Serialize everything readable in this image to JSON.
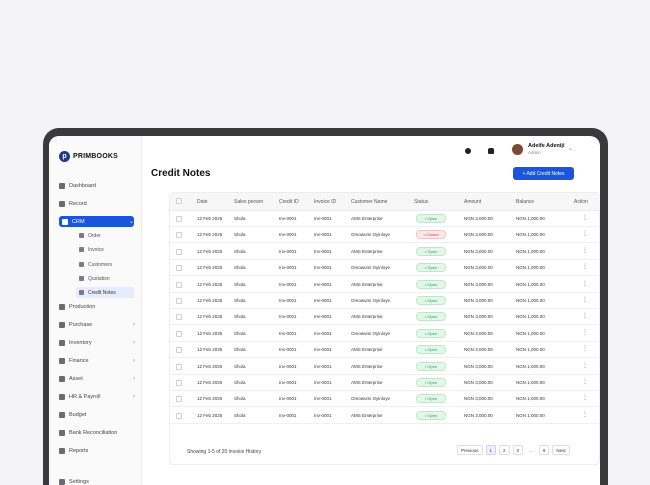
{
  "app": {
    "logo_text": "PRIMBOOKS",
    "logo_mark": "p"
  },
  "sidebar": {
    "items": [
      {
        "label": "Dashboard",
        "icon": "grid-icon",
        "chevron": false
      },
      {
        "label": "Record",
        "icon": "archive-icon",
        "chevron": false
      },
      {
        "label": "CRM",
        "icon": "crm-icon",
        "chevron": true,
        "active": true
      },
      {
        "label": "Production",
        "icon": "factory-icon",
        "chevron": false
      },
      {
        "label": "Purchase",
        "icon": "tag-icon",
        "chevron": true
      },
      {
        "label": "Inventory",
        "icon": "box-icon",
        "chevron": true
      },
      {
        "label": "Finance",
        "icon": "wallet-icon",
        "chevron": true
      },
      {
        "label": "Asset",
        "icon": "asset-icon",
        "chevron": true
      },
      {
        "label": "HR & Payroll",
        "icon": "people-icon",
        "chevron": true
      },
      {
        "label": "Budget",
        "icon": "budget-icon",
        "chevron": false
      },
      {
        "label": "Bank Reconciliation",
        "icon": "bank-icon",
        "chevron": false
      },
      {
        "label": "Reports",
        "icon": "report-icon",
        "chevron": false
      },
      {
        "label": "Settings",
        "icon": "gear-icon",
        "chevron": false
      }
    ],
    "crm_sub": [
      {
        "label": "Order",
        "icon": "bag-icon"
      },
      {
        "label": "Invoice",
        "icon": "document-icon"
      },
      {
        "label": "Customers",
        "icon": "users-icon"
      },
      {
        "label": "Quotation",
        "icon": "document-icon"
      },
      {
        "label": "Credit Notes",
        "icon": "note-icon",
        "active": true
      }
    ]
  },
  "topbar": {
    "user_name": "Adeife Adeniji",
    "user_role": "Admin"
  },
  "page": {
    "title": "Credit Notes",
    "add_button": "+ Add Credit Notes"
  },
  "table": {
    "headers": [
      "Date",
      "Sales person",
      "Credit ID",
      "Invoice ID",
      "Customer Name",
      "Status",
      "Amount",
      "Balance",
      "Action"
    ],
    "rows": [
      {
        "date": "12 Feb 2025",
        "sales": "Shola",
        "credit": "Inv-0001",
        "invoice": "Inv-0001",
        "customer": "AMS Enterprise",
        "status": "Open",
        "amount": "NGN 3,000.00",
        "balance": "NGN 1,000.00"
      },
      {
        "date": "12 Feb 2025",
        "sales": "Shola",
        "credit": "Inv-0001",
        "invoice": "Inv-0001",
        "customer": "Omowumi Oyinloye",
        "status": "Closed",
        "amount": "NGN 3,000.00",
        "balance": "NGN 1,000.00"
      },
      {
        "date": "12 Feb 2025",
        "sales": "Shola",
        "credit": "Inv-0001",
        "invoice": "Inv-0001",
        "customer": "AMS Enterprise",
        "status": "Open",
        "amount": "NGN 3,000.00",
        "balance": "NGN 1,000.00"
      },
      {
        "date": "12 Feb 2025",
        "sales": "Shola",
        "credit": "Inv-0001",
        "invoice": "Inv-0001",
        "customer": "Omowumi Oyinloye",
        "status": "Open",
        "amount": "NGN 3,000.00",
        "balance": "NGN 1,000.00"
      },
      {
        "date": "12 Feb 2025",
        "sales": "Shola",
        "credit": "Inv-0001",
        "invoice": "Inv-0001",
        "customer": "AMS Enterprise",
        "status": "Open",
        "amount": "NGN 3,000.00",
        "balance": "NGN 1,000.00"
      },
      {
        "date": "12 Feb 2025",
        "sales": "Shola",
        "credit": "Inv-0001",
        "invoice": "Inv-0001",
        "customer": "Omowumi Oyinloye",
        "status": "Open",
        "amount": "NGN 3,000.00",
        "balance": "NGN 1,000.00"
      },
      {
        "date": "12 Feb 2025",
        "sales": "Shola",
        "credit": "Inv-0001",
        "invoice": "Inv-0001",
        "customer": "AMS Enterprise",
        "status": "Open",
        "amount": "NGN 3,000.00",
        "balance": "NGN 1,000.00"
      },
      {
        "date": "12 Feb 2025",
        "sales": "Shola",
        "credit": "Inv-0001",
        "invoice": "Inv-0001",
        "customer": "Omowumi Oyinloye",
        "status": "Open",
        "amount": "NGN 3,000.00",
        "balance": "NGN 1,000.00"
      },
      {
        "date": "12 Feb 2025",
        "sales": "Shola",
        "credit": "Inv-0001",
        "invoice": "Inv-0001",
        "customer": "AMS Enterprise",
        "status": "Open",
        "amount": "NGN 3,000.00",
        "balance": "NGN 1,000.00"
      },
      {
        "date": "12 Feb 2025",
        "sales": "Shola",
        "credit": "Inv-0001",
        "invoice": "Inv-0001",
        "customer": "AMS Enterprise",
        "status": "Open",
        "amount": "NGN 3,000.00",
        "balance": "NGN 1,000.00"
      },
      {
        "date": "12 Feb 2025",
        "sales": "Shola",
        "credit": "Inv-0001",
        "invoice": "Inv-0001",
        "customer": "AMS Enterprise",
        "status": "Open",
        "amount": "NGN 3,000.00",
        "balance": "NGN 1,000.00"
      },
      {
        "date": "12 Feb 2025",
        "sales": "Shola",
        "credit": "Inv-0001",
        "invoice": "Inv-0001",
        "customer": "Omowumi Oyinloye",
        "status": "Open",
        "amount": "NGN 3,000.00",
        "balance": "NGN 1,000.00"
      },
      {
        "date": "12 Feb 2025",
        "sales": "Shola",
        "credit": "Inv-0001",
        "invoice": "Inv-0001",
        "customer": "AMS Enterprise",
        "status": "Open",
        "amount": "NGN 3,000.00",
        "balance": "NGN 1,000.00"
      }
    ],
    "status_prefix": "• "
  },
  "footer": {
    "summary": "Showing 1-5 of 20 invoice History",
    "pager": [
      "Previous",
      "1",
      "2",
      "3",
      "...",
      "9",
      "Next"
    ]
  },
  "colors": {
    "accent": "#1a56db",
    "open": "#2e9e4f",
    "closed": "#d64545"
  }
}
